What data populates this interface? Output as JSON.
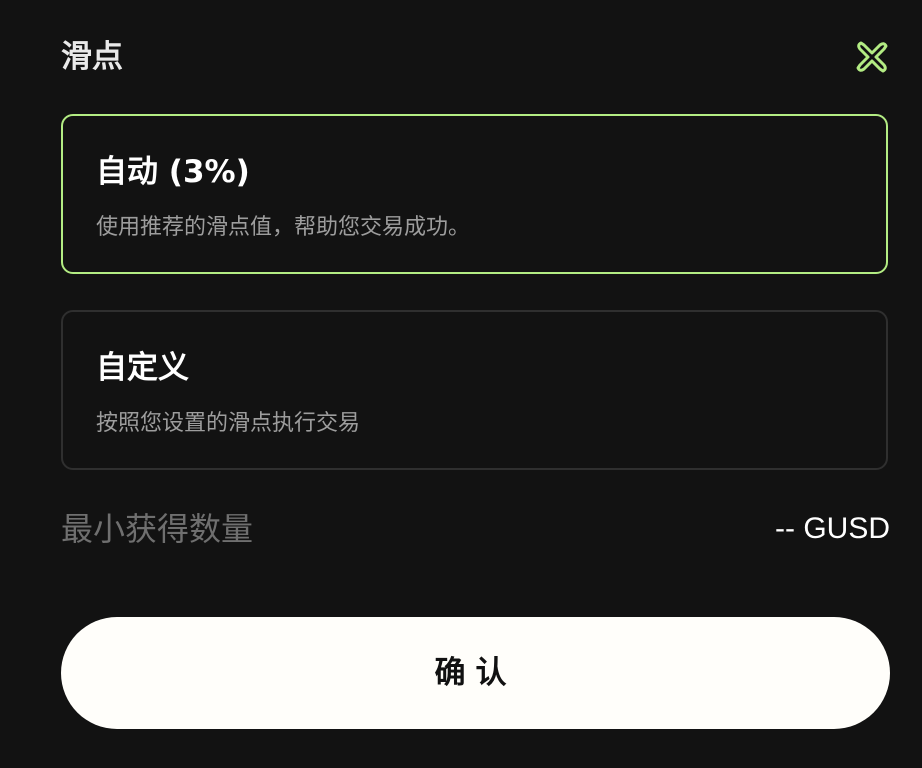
{
  "header": {
    "title": "滑点",
    "close_icon": "close-x-icon",
    "accent_color": "#b3ec83"
  },
  "options": [
    {
      "title": "自动 (3%)",
      "description": "使用推荐的滑点值，帮助您交易成功。",
      "selected": true
    },
    {
      "title": "自定义",
      "description": "按照您设置的滑点执行交易",
      "selected": false
    }
  ],
  "min_received": {
    "label": "最小获得数量",
    "value": "-- GUSD"
  },
  "confirm_button": {
    "label": "确认"
  }
}
